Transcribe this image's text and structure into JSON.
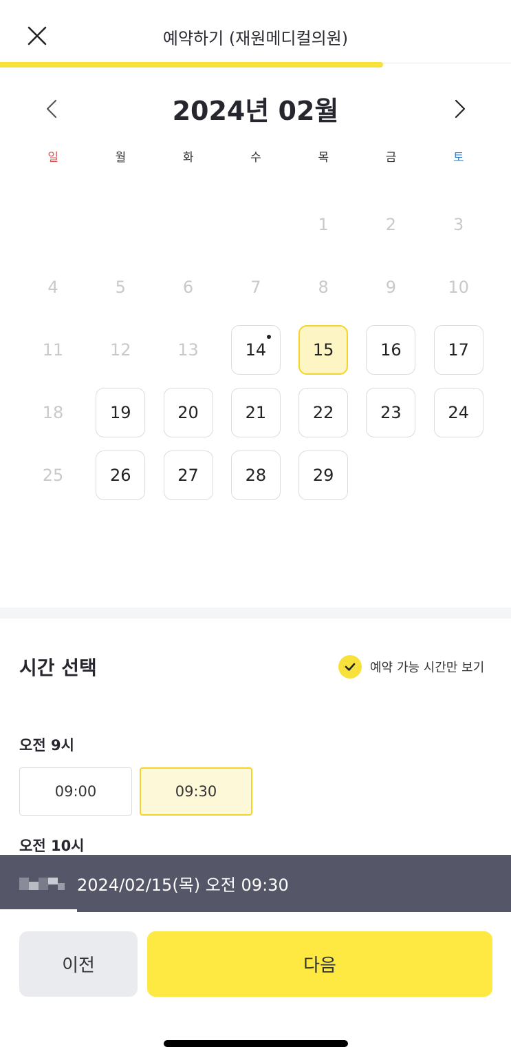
{
  "header": {
    "title": "예약하기 (재원메디컬의원)",
    "progress_fraction": 0.75,
    "accent_color": "#f8e13a"
  },
  "calendar": {
    "month_title": "2024년 02월",
    "weekdays": [
      "일",
      "월",
      "화",
      "수",
      "목",
      "금",
      "토"
    ],
    "weeks": [
      [
        {
          "day": "",
          "state": "empty"
        },
        {
          "day": "",
          "state": "empty"
        },
        {
          "day": "",
          "state": "empty"
        },
        {
          "day": "",
          "state": "empty"
        },
        {
          "day": "1",
          "state": "disabled"
        },
        {
          "day": "2",
          "state": "disabled"
        },
        {
          "day": "3",
          "state": "disabled"
        }
      ],
      [
        {
          "day": "4",
          "state": "disabled"
        },
        {
          "day": "5",
          "state": "disabled"
        },
        {
          "day": "6",
          "state": "disabled"
        },
        {
          "day": "7",
          "state": "disabled"
        },
        {
          "day": "8",
          "state": "disabled"
        },
        {
          "day": "9",
          "state": "disabled"
        },
        {
          "day": "10",
          "state": "disabled"
        }
      ],
      [
        {
          "day": "11",
          "state": "disabled"
        },
        {
          "day": "12",
          "state": "disabled"
        },
        {
          "day": "13",
          "state": "disabled"
        },
        {
          "day": "14",
          "state": "available",
          "today": true
        },
        {
          "day": "15",
          "state": "selected"
        },
        {
          "day": "16",
          "state": "available"
        },
        {
          "day": "17",
          "state": "available"
        }
      ],
      [
        {
          "day": "18",
          "state": "disabled"
        },
        {
          "day": "19",
          "state": "available"
        },
        {
          "day": "20",
          "state": "available"
        },
        {
          "day": "21",
          "state": "available"
        },
        {
          "day": "22",
          "state": "available"
        },
        {
          "day": "23",
          "state": "available"
        },
        {
          "day": "24",
          "state": "available"
        }
      ],
      [
        {
          "day": "25",
          "state": "disabled"
        },
        {
          "day": "26",
          "state": "available"
        },
        {
          "day": "27",
          "state": "available"
        },
        {
          "day": "28",
          "state": "available"
        },
        {
          "day": "29",
          "state": "available"
        },
        {
          "day": "",
          "state": "empty"
        },
        {
          "day": "",
          "state": "empty"
        }
      ]
    ]
  },
  "time": {
    "title": "시간 선택",
    "filter_label": "예약 가능 시간만 보기",
    "filter_checked": true,
    "groups": [
      {
        "label": "오전 9시",
        "slots": [
          {
            "time": "09:00",
            "selected": false
          },
          {
            "time": "09:30",
            "selected": true
          }
        ]
      },
      {
        "label": "오전 10시",
        "slots": []
      }
    ]
  },
  "summary": {
    "text": "2024/02/15(목) 오전 09:30"
  },
  "footer": {
    "prev_label": "이전",
    "next_label": "다음"
  },
  "icons": {
    "close": "close-icon",
    "prev_month": "chevron-left-icon",
    "next_month": "chevron-right-icon",
    "check": "check-icon"
  }
}
